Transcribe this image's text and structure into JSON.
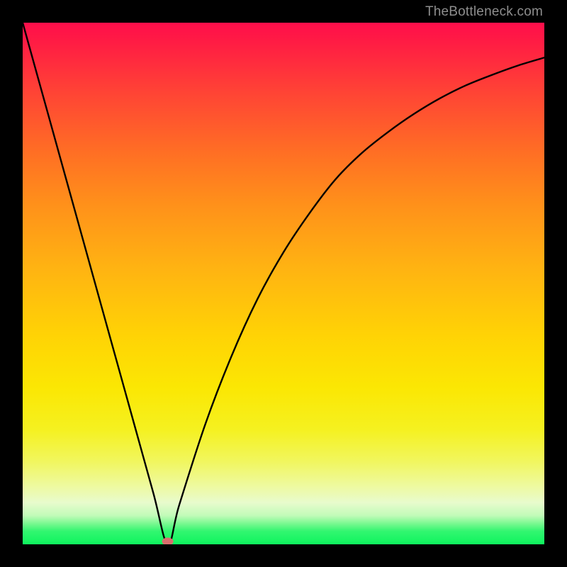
{
  "watermark": "TheBottleneck.com",
  "colors": {
    "background": "#000000",
    "curve_stroke": "#000000",
    "marker_fill": "#d96d6d",
    "marker_fill2": "#e08a8a"
  },
  "chart_data": {
    "type": "line",
    "title": "",
    "xlabel": "",
    "ylabel": "",
    "xlim": [
      0,
      100
    ],
    "ylim": [
      0,
      100
    ],
    "series": [
      {
        "name": "bottleneck-curve",
        "x": [
          0,
          5,
          10,
          15,
          20,
          25,
          27.8,
          30,
          35,
          40,
          45,
          50,
          55,
          60,
          65,
          70,
          75,
          80,
          85,
          90,
          95,
          100
        ],
        "values": [
          100,
          82,
          64,
          46,
          28,
          10,
          0,
          7.5,
          23,
          36,
          47,
          56,
          63.5,
          70,
          75,
          79,
          82.5,
          85.5,
          88,
          90,
          91.8,
          93.3
        ]
      }
    ],
    "annotations": [
      {
        "type": "marker",
        "shape": "ellipse",
        "x": 27.8,
        "y": 0,
        "label": "optimal-point"
      }
    ],
    "grid": false,
    "legend": false
  }
}
